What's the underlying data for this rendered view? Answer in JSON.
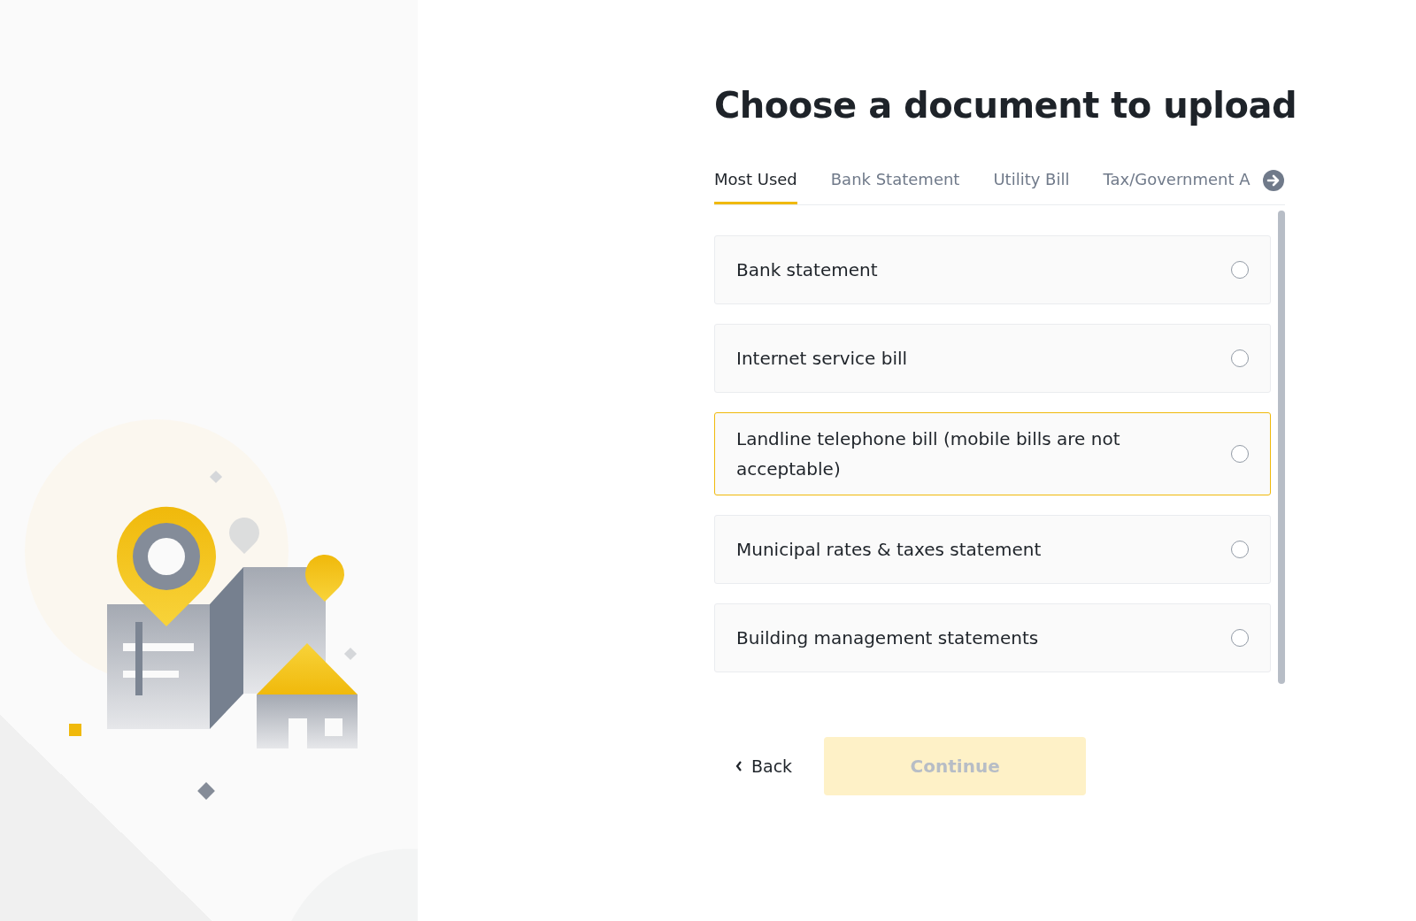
{
  "heading": "Choose a document to upload",
  "tabs": [
    {
      "label": "Most Used",
      "selected": true
    },
    {
      "label": "Bank Statement",
      "selected": false
    },
    {
      "label": "Utility Bill",
      "selected": false
    },
    {
      "label": "Tax/Government A",
      "selected": false
    }
  ],
  "options": [
    {
      "label": "Bank statement",
      "selected": false,
      "hovered": false
    },
    {
      "label": "Internet service bill",
      "selected": false,
      "hovered": false
    },
    {
      "label": "Landline telephone bill (mobile bills are not acceptable)",
      "selected": false,
      "hovered": true
    },
    {
      "label": "Municipal rates & taxes statement",
      "selected": false,
      "hovered": false
    },
    {
      "label": "Building management statements",
      "selected": false,
      "hovered": false
    }
  ],
  "back_button": {
    "label": "Back"
  },
  "continue_button": {
    "label": "Continue",
    "disabled": true
  }
}
